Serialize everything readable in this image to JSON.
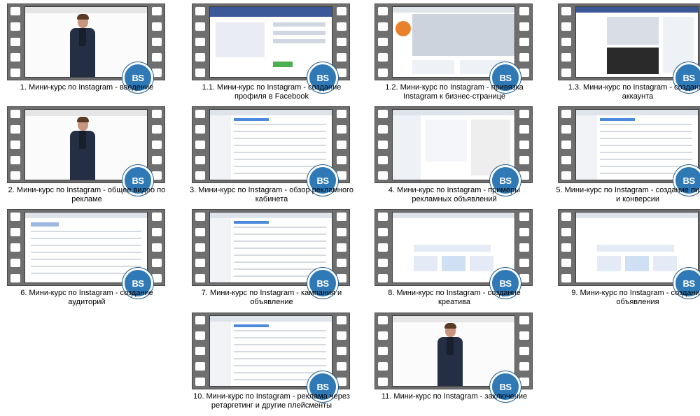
{
  "badge_label": "BS",
  "colors": {
    "filmstrip": "#6f6f6f",
    "badge": "#2f79b6"
  },
  "videos": [
    {
      "title": "1. Мини-курс по Instagram - введение",
      "thumb": "person"
    },
    {
      "title": "1.1. Мини-курс по Instagram - создание профиля в Facebook",
      "thumb": "facebook-signup"
    },
    {
      "title": "1.2. Мини-курс по Instagram - привязка Instagram к бизнес-странице",
      "thumb": "business-page"
    },
    {
      "title": "1.3. Мини-курс по Instagram - создание аккаунта",
      "thumb": "feed"
    },
    {
      "title": "2. Мини-курс по Instagram - общее видео по рекламе",
      "thumb": "person"
    },
    {
      "title": "3. Мини-курс по Instagram - обзор рекламного кабинета",
      "thumb": "table"
    },
    {
      "title": "4. Мини-курс по Instagram - примеры рекламных объявлений",
      "thumb": "ads-library"
    },
    {
      "title": "5. Мини-курс по Instagram - создание пикселя и конверсии",
      "thumb": "table"
    },
    {
      "title": "6. Мини-курс по Instagram - создание аудиторий",
      "thumb": "audiences"
    },
    {
      "title": "7. Мини-курс по Instagram - кампания и объявление",
      "thumb": "table"
    },
    {
      "title": "8. Мини-курс по Instagram - создание креатива",
      "thumb": "creative"
    },
    {
      "title": "9. Мини-курс по Instagram - создание объявления",
      "thumb": "creative"
    },
    {
      "title": "10. Мини-курс по Instagram - реклама через ретаргетинг и другие плейсменты",
      "thumb": "table"
    },
    {
      "title": "11. Мини-курс по Instagram - заключение",
      "thumb": "person"
    }
  ]
}
